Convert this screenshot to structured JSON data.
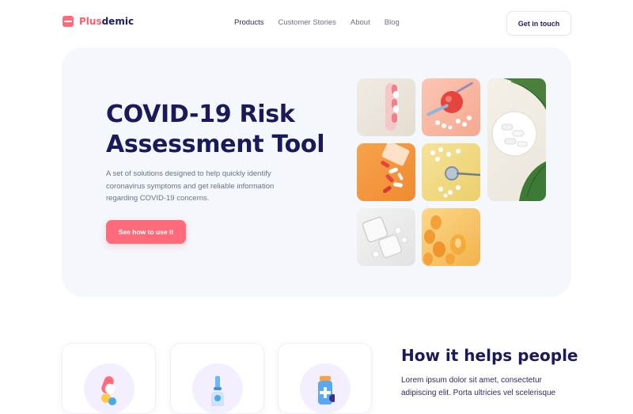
{
  "header": {
    "logo": {
      "part1": "Plus",
      "part2": "demic"
    },
    "nav": [
      {
        "label": "Products",
        "active": true
      },
      {
        "label": "Customer Stories",
        "active": false
      },
      {
        "label": "About",
        "active": false
      },
      {
        "label": "Blog",
        "active": false
      }
    ],
    "cta_label": "Get in touch"
  },
  "hero": {
    "title_line1": "COVID-19 Risk",
    "title_line2": "Assessment Tool",
    "description": "A set of solutions designed to help quickly identify coronavirus symptoms and get reliable information regarding COVID-19 concerns.",
    "button_label": "See how to use it",
    "images": [
      "pills-hand",
      "apple-syringe",
      "capsules-leaf",
      "spilled-pills",
      "stethoscope",
      "glass-pills",
      "vitamins"
    ]
  },
  "section": {
    "title": "How it helps people",
    "text": "Lorem ipsum dolor sit amet, consectetur adipiscing elit. Porta ultricies vel scelerisque",
    "cards": [
      {
        "icon": "capsule-icon"
      },
      {
        "icon": "test-tube-icon"
      },
      {
        "icon": "medicine-bottle-icon"
      }
    ]
  },
  "colors": {
    "accent": "#ff6b7a",
    "navy": "#1a1a5a",
    "hero_bg": "#f4f7fb"
  }
}
